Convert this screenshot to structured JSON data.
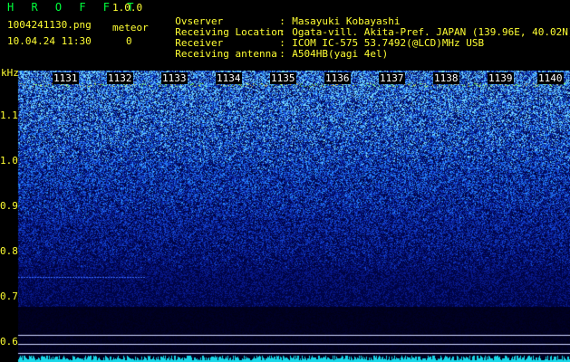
{
  "header": {
    "app_title": "H R O F F T",
    "app_version": "1.0.0",
    "file_name": "1004241130.png",
    "meteor_label": "meteor",
    "timestamp": "10.04.24 11:30",
    "meteor_count": "0"
  },
  "info": [
    {
      "key": "Ovserver",
      "value": "Masayuki Kobayashi"
    },
    {
      "key": "Receiving Location",
      "value": "Ogata-vill. Akita-Pref. JAPAN (139.96E, 40.02N)"
    },
    {
      "key": "Receiver",
      "value": "ICOM IC-575 53.7492(@LCD)MHz USB"
    },
    {
      "key": "Receiving antenna",
      "value": "A504HB(yagi 4el)"
    }
  ],
  "spectrogram": {
    "y_unit": "kHz",
    "y_ticks": [
      "1.1",
      "1.0",
      "0.9",
      "0.8",
      "0.7",
      "0.6"
    ],
    "minute_labels": [
      "1131",
      "1132",
      "1133",
      "1134",
      "1135",
      "1136",
      "1137",
      "1138",
      "1139",
      "1140"
    ],
    "colors": {
      "noise_low": "#00004a",
      "noise_high": "#38b0ff",
      "text_yellow": "#ffff33",
      "title_green": "#00ff3c"
    }
  }
}
